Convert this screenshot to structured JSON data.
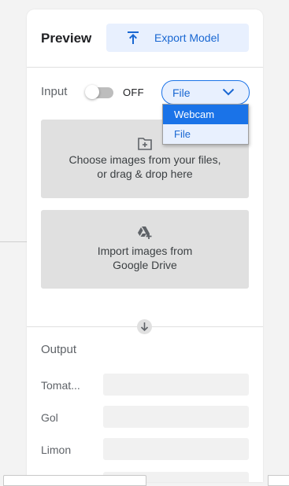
{
  "preview": {
    "title": "Preview",
    "export_label": "Export Model"
  },
  "input": {
    "label": "Input",
    "toggle_state": "OFF",
    "source_selected": "File",
    "source_options": [
      "Webcam",
      "File"
    ],
    "highlighted_option": "Webcam"
  },
  "upload": {
    "files_line1": "Choose images from your files,",
    "files_line2": "or drag & drop here",
    "drive_line1": "Import images from",
    "drive_line2": "Google Drive"
  },
  "output": {
    "title": "Output",
    "classes": [
      {
        "label": "Tomat...",
        "confidence": 0
      },
      {
        "label": "Gol",
        "confidence": 0
      },
      {
        "label": "Limon",
        "confidence": 0
      }
    ]
  },
  "colors": {
    "accent": "#1a73e8",
    "accent_light": "#e8f0fe",
    "dropzone": "#e0e0e0"
  }
}
